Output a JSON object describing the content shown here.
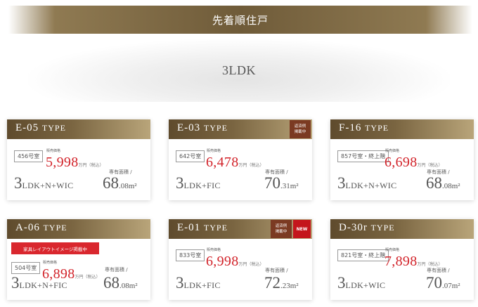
{
  "header": {
    "title": "先着順住戸"
  },
  "plan": {
    "label": "3LDK"
  },
  "cards": [
    {
      "type_code": "E-05",
      "type_word": "TYPE",
      "room": "456号室",
      "price_caption": "販売価格",
      "price": "5,998",
      "price_unit": "万円（税込）",
      "area_caption": "専有面積 /",
      "layout_num": "3",
      "layout_rest": "LDK+N+WIC",
      "area_int": "68",
      "area_dec": ".08m²"
    },
    {
      "type_code": "E-03",
      "type_word": "TYPE",
      "badge_lines": [
        "返済例",
        "掲載中"
      ],
      "room": "642号室",
      "price_caption": "販売価格",
      "price": "6,478",
      "price_unit": "万円（税込）",
      "area_caption": "専有面積 /",
      "layout_num": "3",
      "layout_rest": "LDK+FIC",
      "area_int": "70",
      "area_dec": ".31m²"
    },
    {
      "type_code": "F-16",
      "type_word": "TYPE",
      "room": "857号室・終上階",
      "price_caption": "販売価格",
      "price": "6,698",
      "price_unit": "万円（税込）",
      "area_caption": "専有面積 /",
      "layout_num": "3",
      "layout_rest": "LDK+N+WIC",
      "area_int": "68",
      "area_dec": ".08m²"
    },
    {
      "type_code": "A-06",
      "type_word": "TYPE",
      "furniture": "家具レイアウトイメージ掲載中",
      "room": "504号室",
      "price_caption": "販売価格",
      "price": "6,898",
      "price_unit": "万円（税込）",
      "area_caption": "専有面積 /",
      "layout_num": "3",
      "layout_rest": "LDK+N+FIC",
      "area_int": "68",
      "area_dec": ".08m²"
    },
    {
      "type_code": "E-01",
      "type_word": "TYPE",
      "badge_lines": [
        "返済例",
        "掲載中"
      ],
      "new_label": "NEW",
      "room": "833号室",
      "price_caption": "販売価格",
      "price": "6,998",
      "price_unit": "万円（税込）",
      "area_caption": "専有面積 /",
      "layout_num": "3",
      "layout_rest": "LDK+FIC",
      "area_int": "72",
      "area_dec": ".23m²"
    },
    {
      "type_code": "D-30r",
      "type_word": "TYPE",
      "room": "821号室・終上階",
      "price_caption": "販売価格",
      "price": "7,898",
      "price_unit": "万円（税込）",
      "area_caption": "専有面積 /",
      "layout_num": "3",
      "layout_rest": "LDK+WIC",
      "area_int": "70",
      "area_dec": ".07m²"
    }
  ]
}
